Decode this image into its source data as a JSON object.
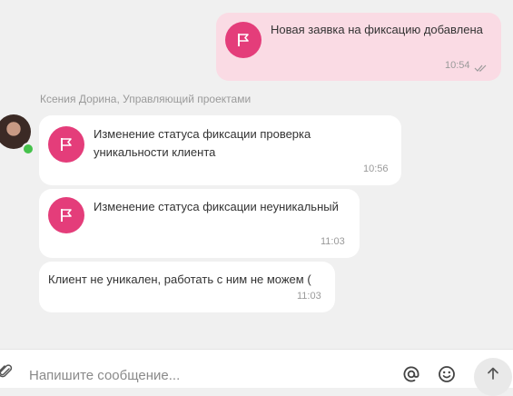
{
  "messages": [
    {
      "text": "Новая заявка на фиксацию добавлена",
      "time": "10:54"
    },
    {
      "text": "Изменение статуса фиксации проверка уникальности клиента",
      "time": "10:56"
    },
    {
      "text": "Изменение статуса фиксации неуникальный",
      "time": "11:03"
    },
    {
      "text": "Клиент не уникален, работать с ним не можем (",
      "time": "11:03"
    }
  ],
  "sender": {
    "name": "Ксения Дорина, Управляющий проектами"
  },
  "composer": {
    "placeholder": "Напишите сообщение..."
  },
  "icons": {
    "status": "flag-icon",
    "read": "double-check-icon",
    "attach": "paperclip-icon",
    "mention": "at-icon",
    "emoji": "emoji-icon",
    "send": "arrow-up-icon"
  },
  "colors": {
    "outgoing_bubble": "#fadbe4",
    "flag_badge": "#e43d7a",
    "online": "#45c24b"
  }
}
